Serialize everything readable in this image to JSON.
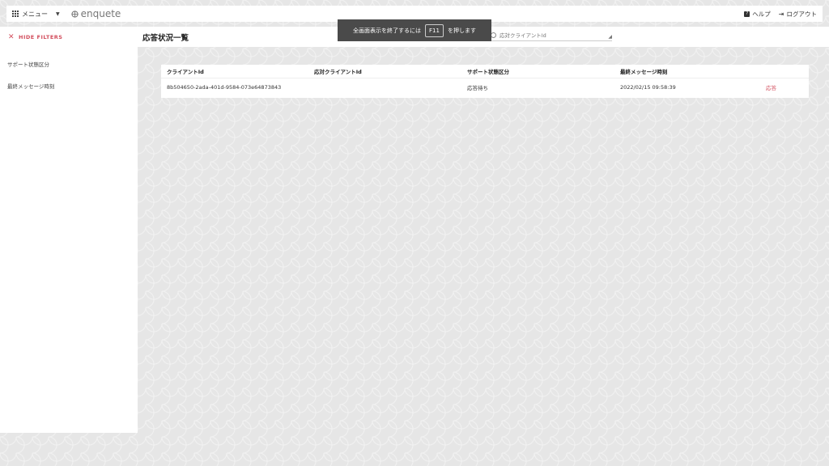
{
  "header": {
    "menu_label": "メニュー",
    "brand": "enquete",
    "help_label": "ヘルプ",
    "logout_label": "ログアウト"
  },
  "toast": {
    "text_before": "全画面表示を終了するには",
    "key": "F11",
    "text_after": "を押します"
  },
  "sidebar": {
    "hide_filters": "HIDE FILTERS",
    "filters": [
      "サポート状態区分",
      "最終メッセージ時刻"
    ]
  },
  "main": {
    "title": "応答状況一覧",
    "search_placeholder": "応対クライアントId"
  },
  "table": {
    "columns": [
      "クライアントId",
      "応対クライアントId",
      "サポート状態区分",
      "最終メッセージ時刻"
    ],
    "rows": [
      {
        "client_id": "8b504650-2ada-401d-9584-073e64873843",
        "handling_client_id": "",
        "support_status": "応答待ち",
        "last_message_time": "2022/02/15 09:58:39",
        "action": "応答"
      }
    ]
  },
  "colors": {
    "accent": "#d24d5c",
    "toast_bg": "#4a4a4a"
  }
}
